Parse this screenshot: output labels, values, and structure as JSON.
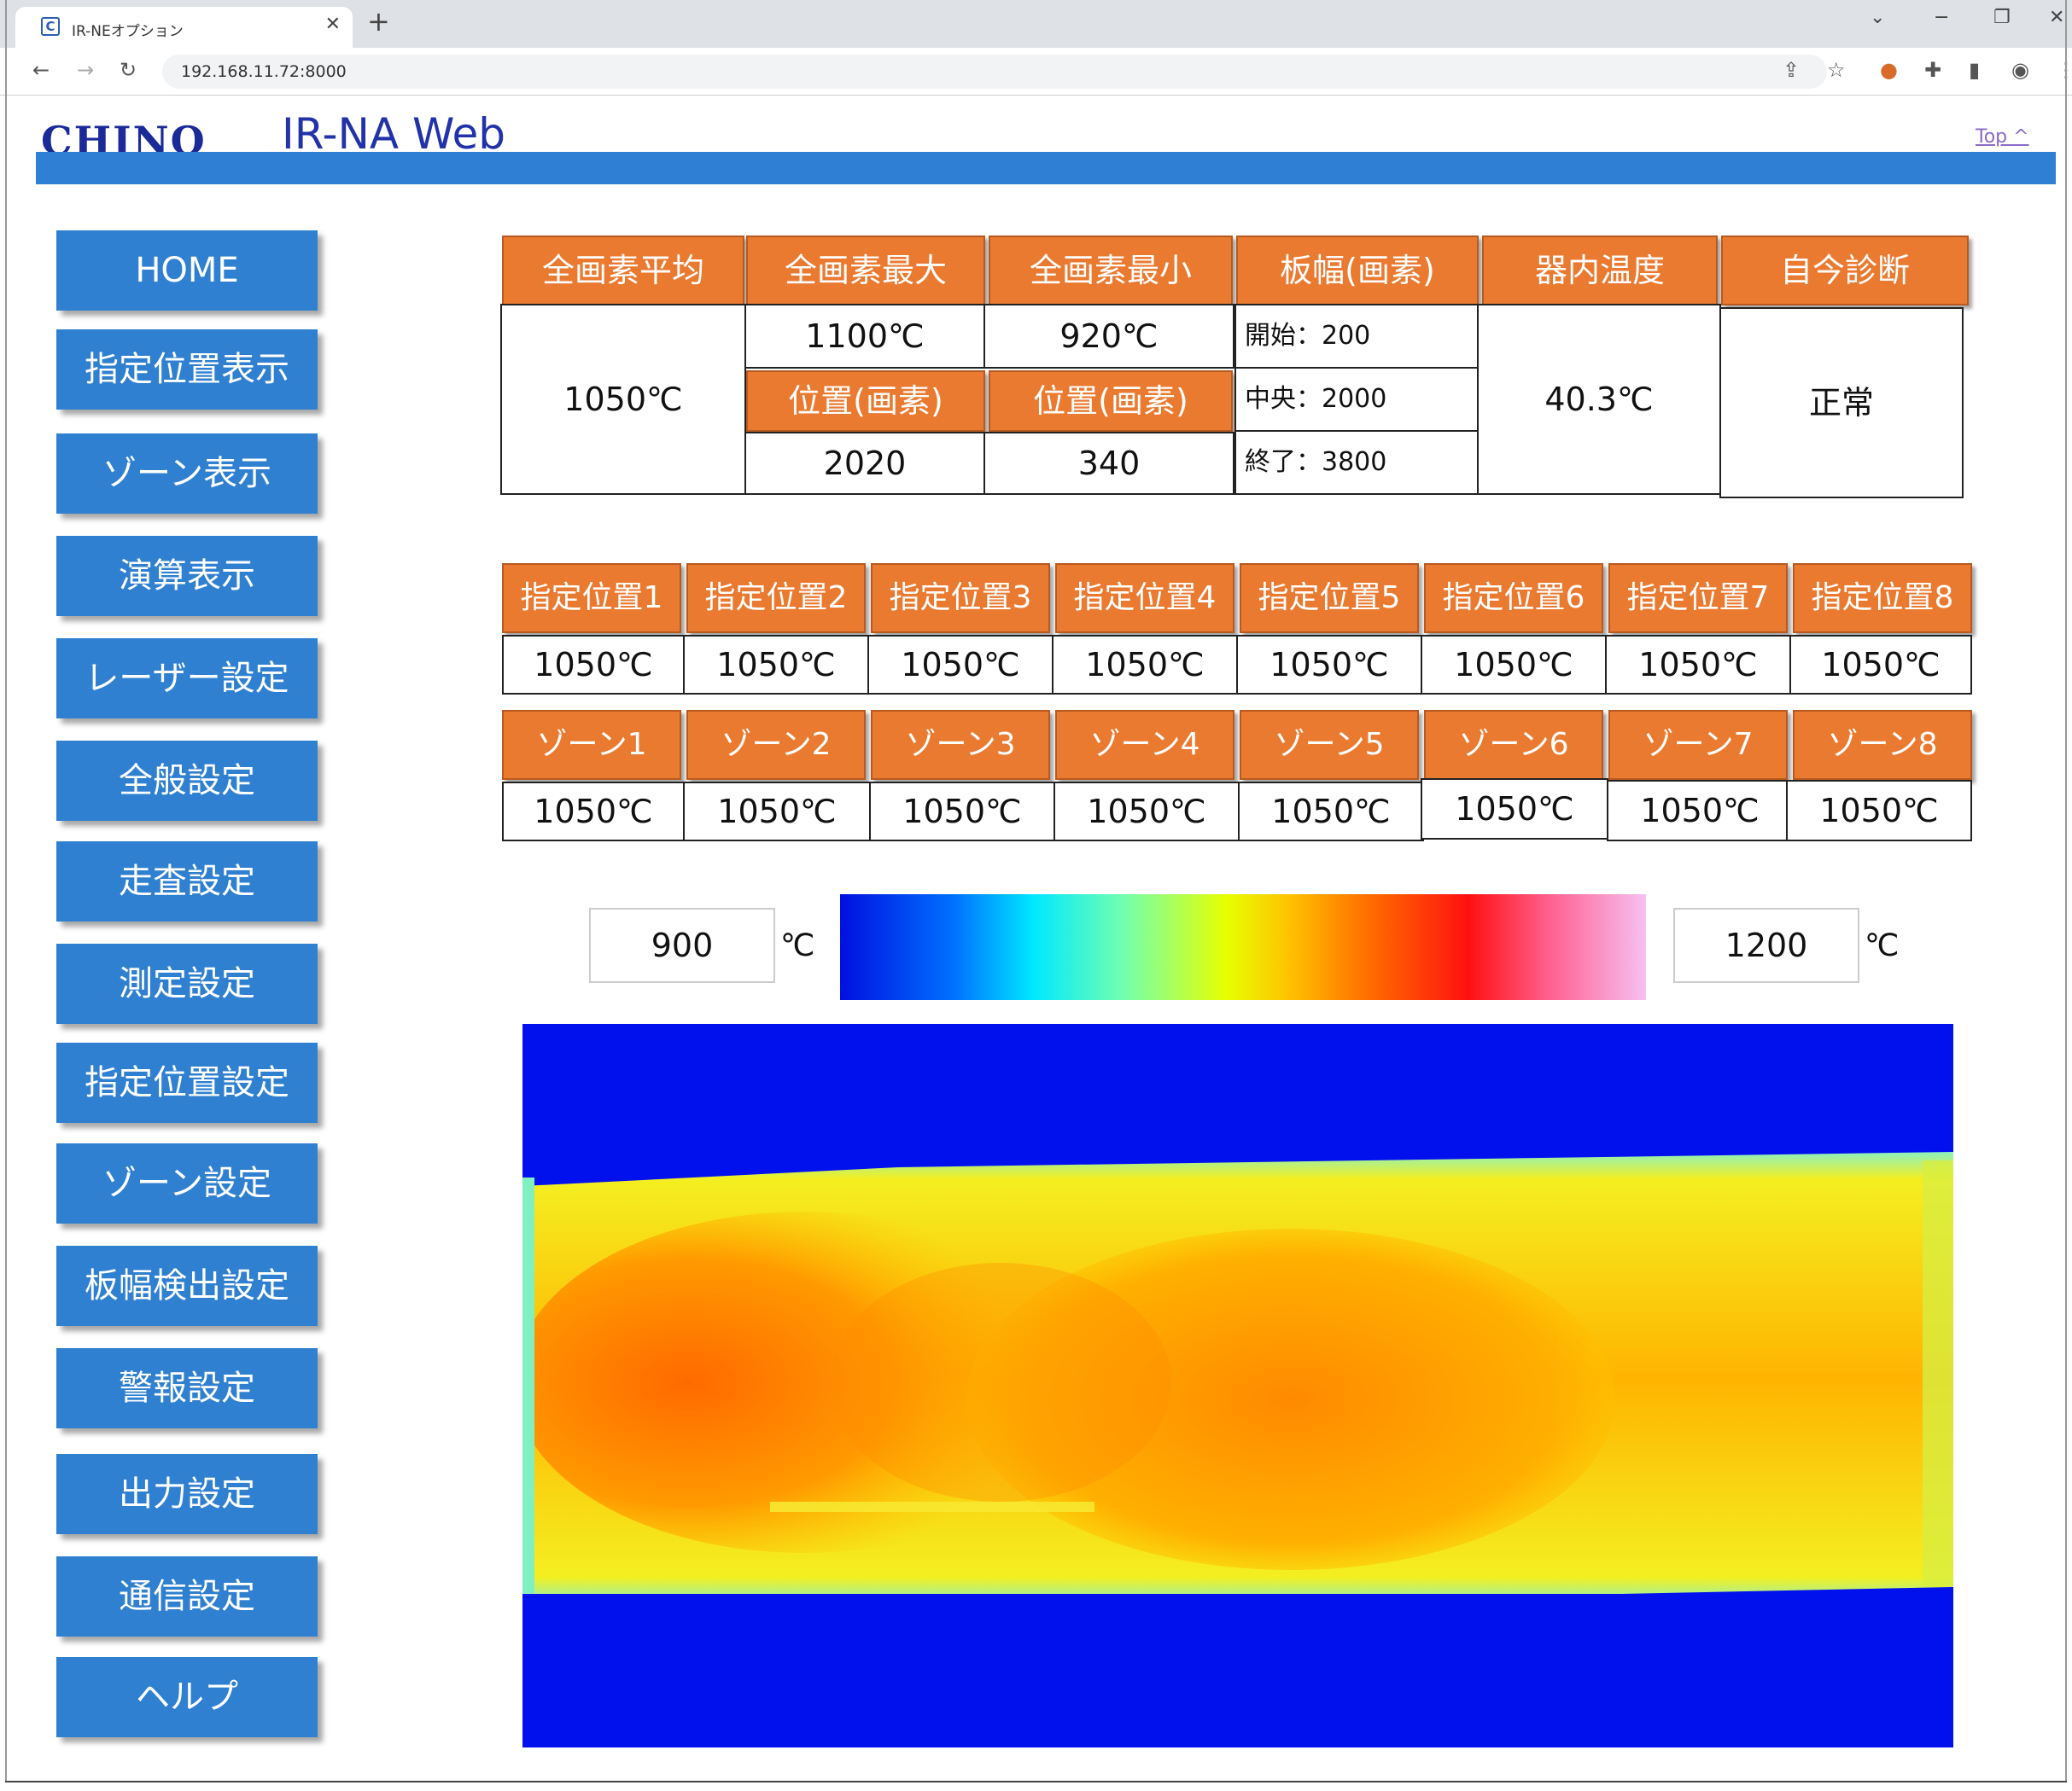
{
  "browser": {
    "tab_title": "IR-NEオプション",
    "url": "192.168.11.72:8000"
  },
  "header": {
    "logo": "CHINO",
    "brand": "IR-NA Web",
    "top_link": "Top ^"
  },
  "sidebar": {
    "items": [
      {
        "label": "HOME"
      },
      {
        "label": "指定位置表示"
      },
      {
        "label": "ゾーン表示"
      },
      {
        "label": "演算表示"
      },
      {
        "label": "レーザー設定"
      },
      {
        "label": "全般設定"
      },
      {
        "label": "走査設定"
      },
      {
        "label": "測定設定"
      },
      {
        "label": "指定位置設定"
      },
      {
        "label": "ゾーン設定"
      },
      {
        "label": "板幅検出設定"
      },
      {
        "label": "警報設定"
      },
      {
        "label": "出力設定"
      },
      {
        "label": "通信設定"
      },
      {
        "label": "ヘルプ"
      }
    ]
  },
  "summary": {
    "headers": {
      "avg": "全画素平均",
      "max": "全画素最大",
      "min": "全画素最小",
      "width": "板幅(画素)",
      "internal_temp": "器内温度",
      "diag": "自今診断"
    },
    "avg_value": "1050℃",
    "max_value": "1100℃",
    "min_value": "920℃",
    "max_pos_label": "位置(画素)",
    "min_pos_label": "位置(画素)",
    "max_pos": "2020",
    "min_pos": "340",
    "width_start": "開始：200",
    "width_center": "中央：2000",
    "width_end": "終了：3800",
    "internal_temp_value": "40.3℃",
    "diag_value": "正常"
  },
  "positions": {
    "labels": [
      "指定位置1",
      "指定位置2",
      "指定位置3",
      "指定位置4",
      "指定位置5",
      "指定位置6",
      "指定位置7",
      "指定位置8"
    ],
    "values": [
      "1050℃",
      "1050℃",
      "1050℃",
      "1050℃",
      "1050℃",
      "1050℃",
      "1050℃",
      "1050℃"
    ]
  },
  "zones": {
    "labels": [
      "ゾーン1",
      "ゾーン2",
      "ゾーン3",
      "ゾーン4",
      "ゾーン5",
      "ゾーン6",
      "ゾーン7",
      "ゾーン8"
    ],
    "values": [
      "1050℃",
      "1050℃",
      "1050℃",
      "1050℃",
      "1050℃",
      "1050℃",
      "1050℃",
      "1050℃"
    ]
  },
  "scale": {
    "min": "900",
    "max": "1200",
    "unit": "℃"
  },
  "colors": {
    "accent_blue": "#2f80d0",
    "header_orange": "#ea7a30",
    "background_blue": "#0011ee"
  }
}
